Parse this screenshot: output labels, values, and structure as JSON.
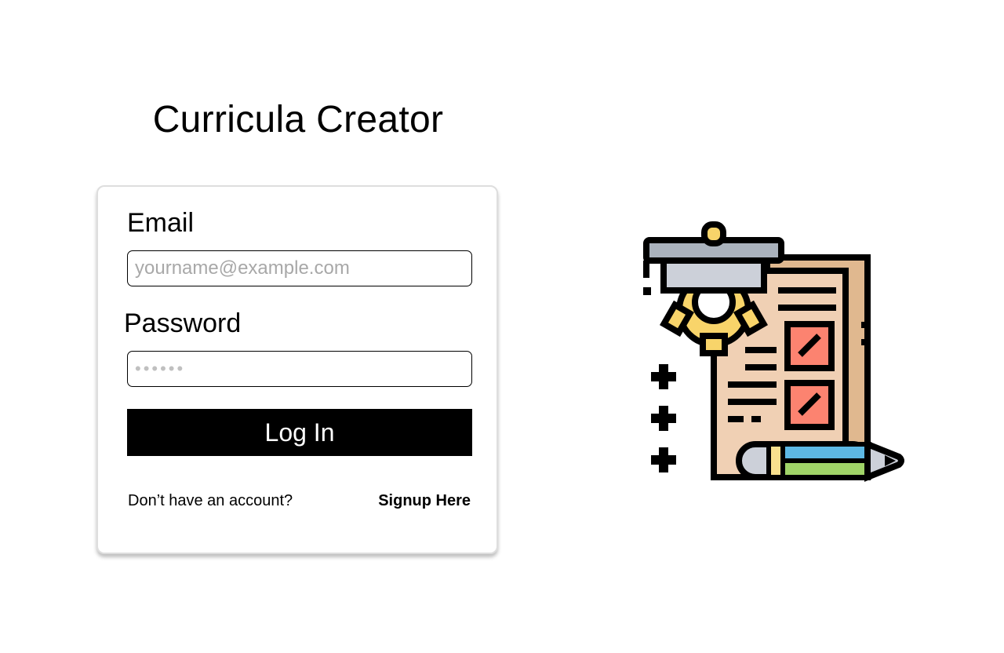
{
  "app": {
    "title": "Curricula Creator"
  },
  "login_form": {
    "email_label": "Email",
    "email_placeholder": "yourname@example.com",
    "email_value": "",
    "password_label": "Password",
    "password_placeholder": "••••••",
    "password_value": "",
    "submit_label": "Log In",
    "signup_prompt": "Don’t have an account?",
    "signup_link": "Signup Here"
  },
  "illustration": {
    "icon": "curriculum-document-gear-pencil-icon"
  },
  "colors": {
    "background": "#ffffff",
    "button": "#000000",
    "button_text": "#ffffff",
    "card_border": "#dedede",
    "paper": "#f0d0b4",
    "paper_edge": "#e0b88f",
    "gear": "#f8d46a",
    "cap": "#ccd0d9",
    "checkbox": "#fc8370",
    "pencil_blue": "#5db8e4",
    "pencil_green": "#a0d468"
  }
}
